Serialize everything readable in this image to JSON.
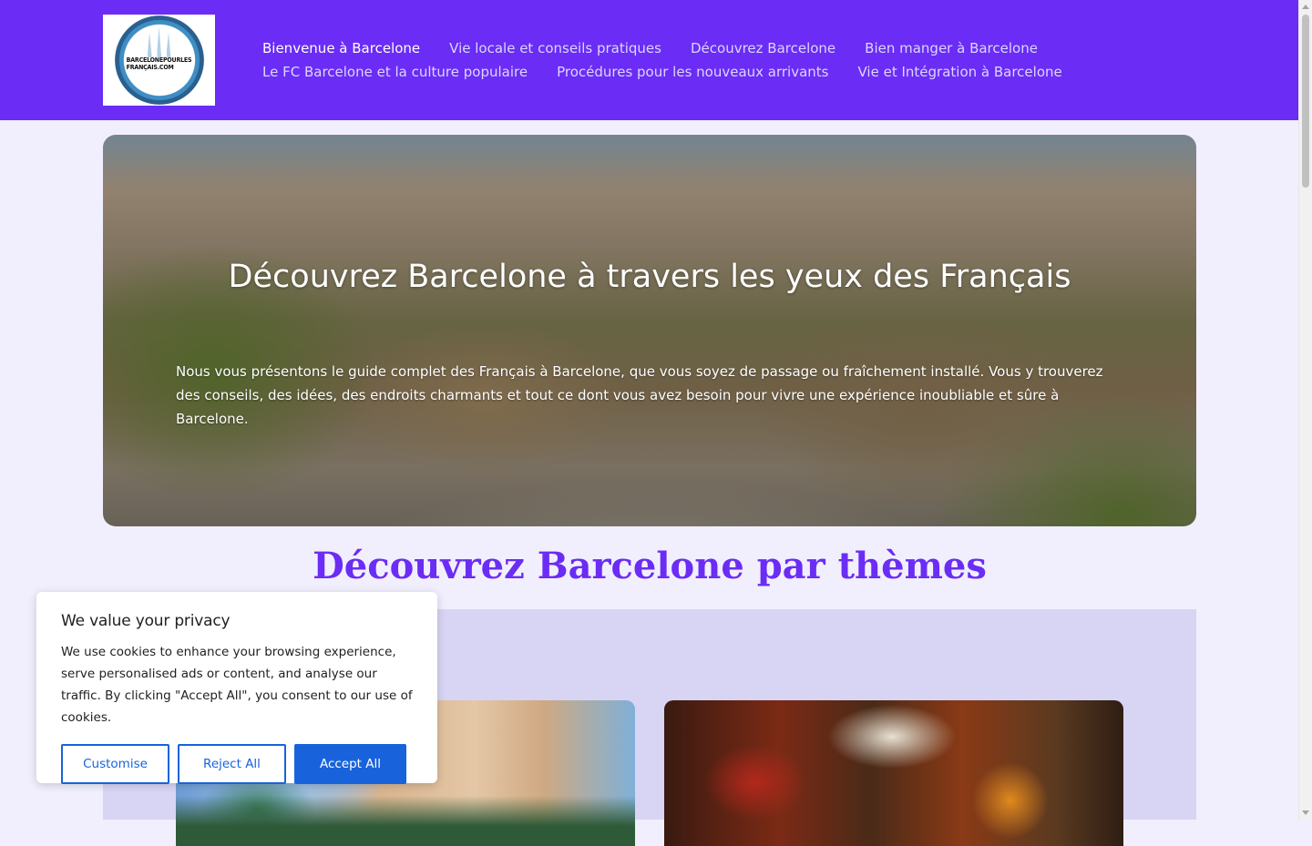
{
  "header": {
    "logo": {
      "text_line1": "BARCELONEPOURLES",
      "text_line2": "FRANÇAIS.COM",
      "icon": "sagrada-familia-logo"
    },
    "nav": {
      "row1": [
        {
          "label": "Bienvenue à Barcelone",
          "active": true
        },
        {
          "label": "Vie locale et conseils pratiques",
          "active": false
        },
        {
          "label": "Découvrez Barcelone",
          "active": false
        },
        {
          "label": "Bien manger à Barcelone",
          "active": false
        }
      ],
      "row2": [
        {
          "label": "Le FC Barcelone et la culture populaire",
          "active": false
        },
        {
          "label": "Procédures pour les nouveaux arrivants",
          "active": false
        },
        {
          "label": "Vie et Intégration à Barcelone",
          "active": false
        }
      ]
    }
  },
  "hero": {
    "title": "Découvrez Barcelone à travers les yeux des Français",
    "text": "Nous vous présentons le guide complet des Français à Barcelone, que vous soyez de passage ou fraîchement installé. Vous y trouverez des conseils, des idées, des endroits charmants et tout ce dont vous avez besoin pour vivre une expérience inoubliable et sûre à Barcelone."
  },
  "themes": {
    "title": "Découvrez Barcelone par thèmes"
  },
  "cookie": {
    "title": "We value your privacy",
    "text": "We use cookies to enhance your browsing experience, serve personalised ads or content, and analyse our traffic. By clicking \"Accept All\", you consent to our use of cookies.",
    "customise_label": "Customise",
    "reject_label": "Reject All",
    "accept_label": "Accept All"
  },
  "colors": {
    "header_bg": "#6b2cf5",
    "accent": "#6b2cf5",
    "cookie_button": "#1863dc",
    "page_bg": "#f1effd",
    "themes_panel_bg": "#d8d4f3"
  }
}
